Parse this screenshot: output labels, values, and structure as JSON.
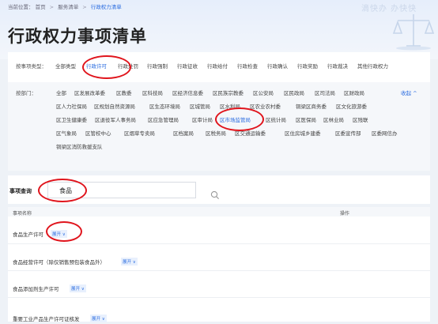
{
  "breadcrumb": {
    "prefix": "当前位置：",
    "home": "首页",
    "service": "服务清单",
    "current": "行政权力清单"
  },
  "slogan": "滴快办 办快快",
  "page_title": "行政权力事项清单",
  "type_filter": {
    "label": "按事项类型：",
    "options": [
      "全部类型",
      "行政许可",
      "行政处罚",
      "行政强制",
      "行政征收",
      "行政给付",
      "行政检查",
      "行政确认",
      "行政奖励",
      "行政裁决",
      "其他行政权力"
    ],
    "selected": "行政许可"
  },
  "dept_filter": {
    "label": "按部门：",
    "options": [
      "全部",
      "区发展改革委",
      "区教委",
      "区科技局",
      "区经济信息委",
      "区民族宗教委",
      "区公安局",
      "区民政局",
      "区司法局",
      "区财政局",
      "区人力社保局",
      "区规划自然资源局",
      "区生态环境局",
      "区城管局",
      "区水利局",
      "区农业农村委",
      "铜梁区商务委",
      "区文化旅游委",
      "区卫生健康委",
      "区退役军人事务局",
      "区应急管理局",
      "区审计局",
      "区市场监管局",
      "区统计局",
      "区医保局",
      "区林业局",
      "区残联",
      "区气象局",
      "区管校中心",
      "区烟草专卖局",
      "区档案局",
      "区税务局",
      "区交通运输委",
      "区住房城乡建委",
      "区委宣传部",
      "区委网信办",
      "铜梁区消防救援支队"
    ],
    "selected": "区市场监管局",
    "collapse_label": "收起 ^"
  },
  "search": {
    "label": "事项查询",
    "value": "食品"
  },
  "table": {
    "col_name": "事项名称",
    "col_action": "操作",
    "expand_label": "展开 ∨",
    "rows": [
      "食品生产许可",
      "食品经营许可（除仅销售预包装食品外）",
      "食品添加剂生产许可",
      "重要工业产品生产许可证核发"
    ]
  },
  "colors": {
    "accent": "#2b6de0",
    "annotation": "#e0141c"
  }
}
